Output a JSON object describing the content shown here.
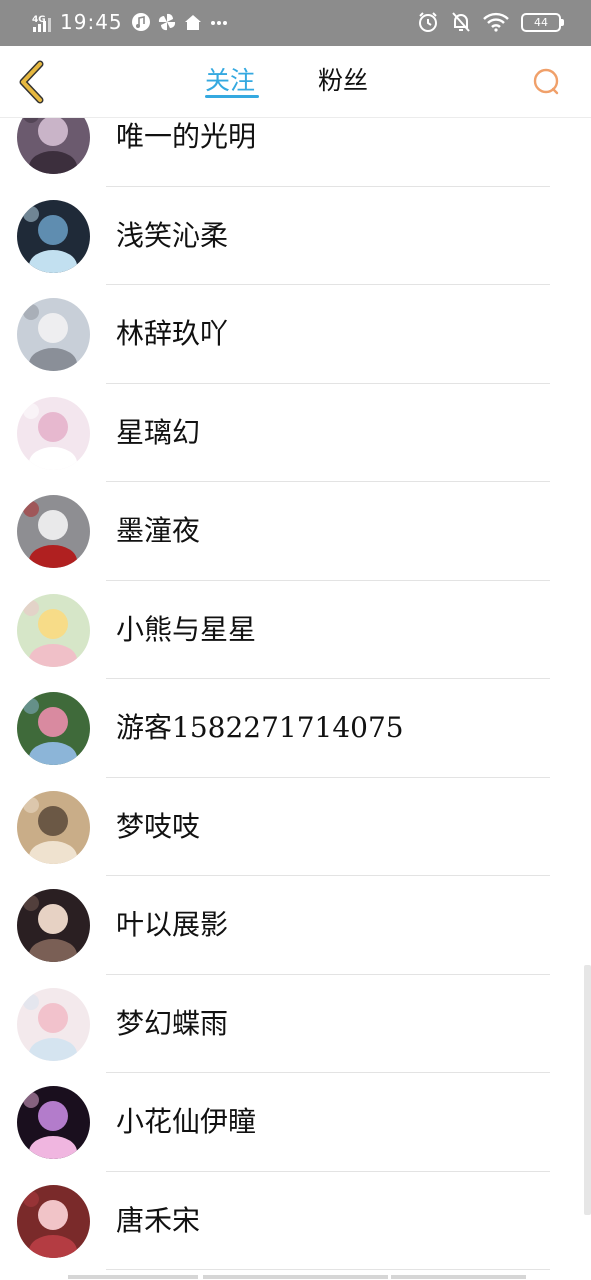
{
  "status_bar": {
    "network": "4G",
    "time": "19:45",
    "battery": "44",
    "left_icons": [
      "music-note-icon",
      "pinwheel-icon",
      "home-icon",
      "more-dots-icon"
    ],
    "right_icons": [
      "alarm-icon",
      "mute-bell-icon",
      "wifi-icon",
      "battery-icon"
    ]
  },
  "nav": {
    "back_icon": "chevron-left-icon",
    "tabs": [
      {
        "label": "关注",
        "active": true
      },
      {
        "label": "粉丝",
        "active": false
      }
    ],
    "search_icon": "search-icon",
    "accent_color": "#35a9e0",
    "back_color": "#e6b840",
    "search_color": "#f0a06a"
  },
  "users": [
    {
      "name": "唯一的光明"
    },
    {
      "name": "浅笑沁柔"
    },
    {
      "name": "林辞玖吖"
    },
    {
      "name": "星璃幻"
    },
    {
      "name": "墨潼夜"
    },
    {
      "name": "小熊与星星"
    },
    {
      "name": "游客1582271714075"
    },
    {
      "name": "梦吱吱"
    },
    {
      "name": "叶以展影"
    },
    {
      "name": "梦幻蝶雨"
    },
    {
      "name": "小花仙伊瞳"
    },
    {
      "name": "唐禾宋"
    }
  ]
}
